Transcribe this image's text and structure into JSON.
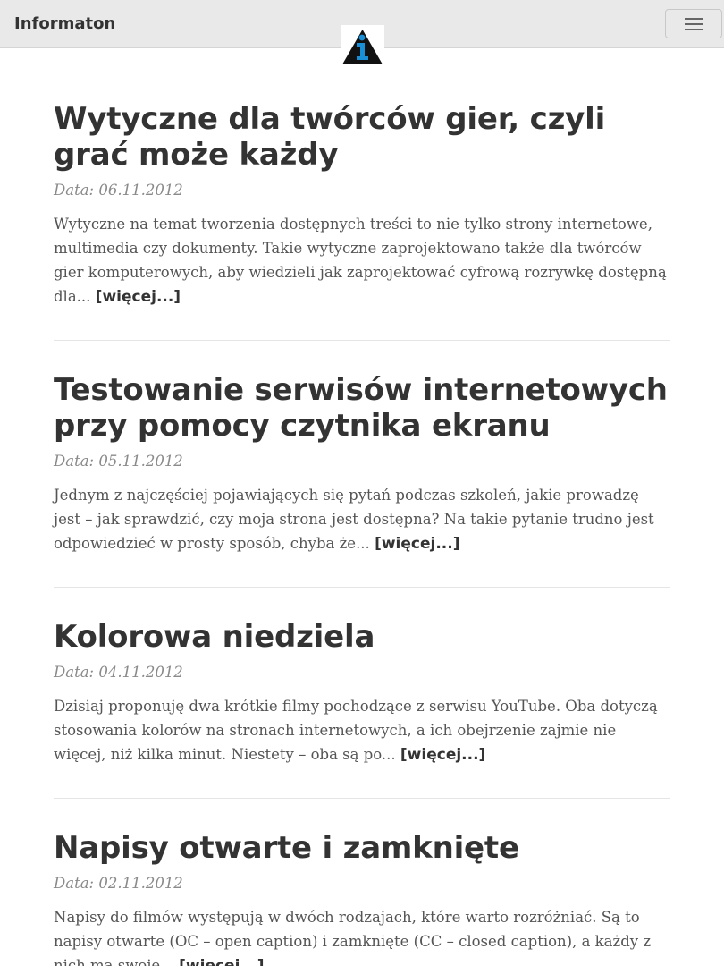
{
  "navbar": {
    "brand": "Informaton",
    "toggler_icon": "hamburger-icon",
    "logo_icon": "info-triangle-logo",
    "colors": {
      "background": "#e9e9e9",
      "logo_accent": "#1a8fd6"
    }
  },
  "posts": [
    {
      "title": "Wytyczne dla twórców gier, czyli grać może każdy",
      "date": "Data: 06.11.2012",
      "excerpt": "Wytyczne na temat tworzenia dostępnych treści to nie tylko strony internetowe, multimedia czy dokumenty. Takie wytyczne zaprojektowano także dla twórców gier komputerowych, aby wiedzieli jak zaprojektować cyfrową rozrywkę dostępną dla...",
      "more": "[więcej...]"
    },
    {
      "title": "Testowanie serwisów internetowych przy pomocy czytnika ekranu",
      "date": "Data: 05.11.2012",
      "excerpt": "Jednym z najczęściej pojawiających się pytań podczas szkoleń, jakie prowadzę jest – jak sprawdzić, czy moja strona jest dostępna? Na takie pytanie trudno jest odpowiedzieć w prosty sposób, chyba że...",
      "more": "[więcej...]"
    },
    {
      "title": "Kolorowa niedziela",
      "date": "Data: 04.11.2012",
      "excerpt": "Dzisiaj proponuję dwa krótkie filmy pochodzące z serwisu YouTube. Oba dotyczą stosowania kolorów na stronach internetowych, a ich obejrzenie zajmie nie więcej, niż kilka minut. Niestety – oba są po...",
      "more": "[więcej...]"
    },
    {
      "title": "Napisy otwarte i zamknięte",
      "date": "Data: 02.11.2012",
      "excerpt": "Napisy do filmów występują w dwóch rodzajach, które warto rozróżniać. Są to napisy otwarte (OC – open caption) i zamknięte (CC – closed caption), a każdy z nich ma swoje...",
      "more": "[więcej...]"
    }
  ]
}
